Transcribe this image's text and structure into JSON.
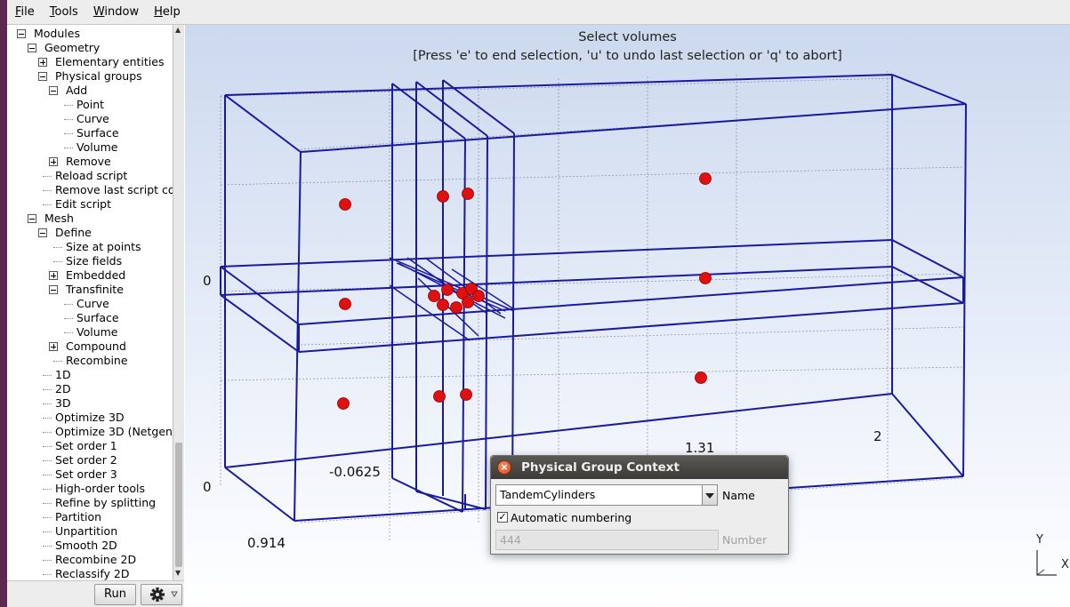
{
  "menubar": {
    "items": [
      {
        "label": "File",
        "mnemonic": "F",
        "rest": "ile"
      },
      {
        "label": "Tools",
        "mnemonic": "T",
        "rest": "ools"
      },
      {
        "label": "Window",
        "mnemonic": "W",
        "rest": "indow"
      },
      {
        "label": "Help",
        "mnemonic": "H",
        "rest": "elp"
      }
    ]
  },
  "tree": {
    "items": [
      {
        "label": "Modules",
        "level": 0,
        "expander": "minus"
      },
      {
        "label": "Geometry",
        "level": 1,
        "expander": "minus"
      },
      {
        "label": "Elementary entities",
        "level": 2,
        "expander": "plus"
      },
      {
        "label": "Physical groups",
        "level": 2,
        "expander": "minus"
      },
      {
        "label": "Add",
        "level": 3,
        "expander": "minus"
      },
      {
        "label": "Point",
        "level": 4,
        "expander": "none"
      },
      {
        "label": "Curve",
        "level": 4,
        "expander": "none"
      },
      {
        "label": "Surface",
        "level": 4,
        "expander": "none"
      },
      {
        "label": "Volume",
        "level": 4,
        "expander": "none"
      },
      {
        "label": "Remove",
        "level": 3,
        "expander": "plus"
      },
      {
        "label": "Reload script",
        "level": 2,
        "expander": "none"
      },
      {
        "label": "Remove last script co",
        "level": 2,
        "expander": "none"
      },
      {
        "label": "Edit script",
        "level": 2,
        "expander": "none"
      },
      {
        "label": "Mesh",
        "level": 1,
        "expander": "minus"
      },
      {
        "label": "Define",
        "level": 2,
        "expander": "minus"
      },
      {
        "label": "Size at points",
        "level": 3,
        "expander": "none"
      },
      {
        "label": "Size fields",
        "level": 3,
        "expander": "none"
      },
      {
        "label": "Embedded",
        "level": 3,
        "expander": "plus"
      },
      {
        "label": "Transfinite",
        "level": 3,
        "expander": "minus"
      },
      {
        "label": "Curve",
        "level": 4,
        "expander": "none"
      },
      {
        "label": "Surface",
        "level": 4,
        "expander": "none"
      },
      {
        "label": "Volume",
        "level": 4,
        "expander": "none"
      },
      {
        "label": "Compound",
        "level": 3,
        "expander": "plus"
      },
      {
        "label": "Recombine",
        "level": 3,
        "expander": "none"
      },
      {
        "label": "1D",
        "level": 2,
        "expander": "none"
      },
      {
        "label": "2D",
        "level": 2,
        "expander": "none"
      },
      {
        "label": "3D",
        "level": 2,
        "expander": "none"
      },
      {
        "label": "Optimize 3D",
        "level": 2,
        "expander": "none"
      },
      {
        "label": "Optimize 3D (Netgen",
        "level": 2,
        "expander": "none"
      },
      {
        "label": "Set order 1",
        "level": 2,
        "expander": "none"
      },
      {
        "label": "Set order 2",
        "level": 2,
        "expander": "none"
      },
      {
        "label": "Set order 3",
        "level": 2,
        "expander": "none"
      },
      {
        "label": "High-order tools",
        "level": 2,
        "expander": "none"
      },
      {
        "label": "Refine by splitting",
        "level": 2,
        "expander": "none"
      },
      {
        "label": "Partition",
        "level": 2,
        "expander": "none"
      },
      {
        "label": "Unpartition",
        "level": 2,
        "expander": "none"
      },
      {
        "label": "Smooth 2D",
        "level": 2,
        "expander": "none"
      },
      {
        "label": "Recombine 2D",
        "level": 2,
        "expander": "none"
      },
      {
        "label": "Reclassify 2D",
        "level": 2,
        "expander": "none"
      }
    ]
  },
  "bottom": {
    "run_label": "Run"
  },
  "graphics": {
    "message_line1": "Select volumes",
    "message_line2": "[Press 'e' to end selection, 'u' to undo last selection or 'q' to abort]",
    "axis_labels": [
      "0",
      "0",
      "0.914",
      "-0.0625",
      "1.31",
      "2"
    ],
    "axes_indicator": {
      "y": "Y",
      "x": "X"
    },
    "line_color": "#1a1aa0",
    "point_color": "#e01010"
  },
  "dialog": {
    "title": "Physical Group Context",
    "close_glyph": "×",
    "name_value": "TandemCylinders",
    "name_label": "Name",
    "auto_checked_glyph": "✓",
    "auto_label": "Automatic numbering",
    "number_value": "444",
    "number_label": "Number"
  }
}
